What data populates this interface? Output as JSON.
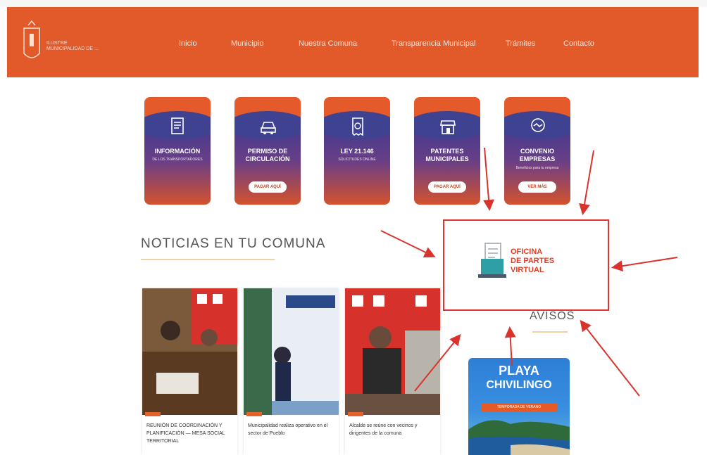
{
  "header": {
    "logo_text": "ILUSTRE MUNICIPALIDAD DE ...",
    "nav": [
      {
        "label": "Inicio"
      },
      {
        "label": "Municipio"
      },
      {
        "label": "Nuestra Comuna"
      },
      {
        "label": "Transparencia Municipal"
      },
      {
        "label": "Trámites"
      },
      {
        "label": "Contacto"
      }
    ]
  },
  "cards": [
    {
      "title": "INFORMACIÓN",
      "subtitle": "DE LOS TRANSPORTADORES",
      "icon": "document-icon",
      "button": ""
    },
    {
      "title": "PERMISO DE CIRCULACIÓN",
      "subtitle": "",
      "icon": "car-icon",
      "button": "PAGAR AQUÍ"
    },
    {
      "title": "LEY 21.146",
      "subtitle": "SOLICITUDES ONLINE",
      "icon": "receipt-icon",
      "button": ""
    },
    {
      "title": "PATENTES MUNICIPALES",
      "subtitle": "",
      "icon": "shop-icon",
      "button": "PAGAR AQUÍ"
    },
    {
      "title": "CONVENIO EMPRESAS",
      "subtitle": "Beneficios para tu empresa",
      "icon": "handshake-icon",
      "button": "VER MÁS"
    }
  ],
  "news_section": {
    "title": "NOTICIAS EN TU COMUNA",
    "items": [
      {
        "caption": "REUNIÓN DE COORDINACIÓN Y PLANIFICACIÓN — MESA SOCIAL TERRITORIAL"
      },
      {
        "caption": "Municipalidad realiza operativo en el sector de Pueblo"
      },
      {
        "caption": "Alcalde se reúne con vecinos y dirigentes de la comuna"
      }
    ]
  },
  "oficina": {
    "line1": "OFICINA",
    "line2": "DE PARTES",
    "line3": "VIRTUAL"
  },
  "avisos": {
    "title": "AVISOS",
    "banner_title1": "PLAYA",
    "banner_title2": "CHIVILINGO",
    "banner_ribbon": "TEMPORADA DE VERANO"
  },
  "colors": {
    "brand_orange": "#e35a2a",
    "card_purple": "#3f4291",
    "highlight_red": "#e0332e"
  }
}
